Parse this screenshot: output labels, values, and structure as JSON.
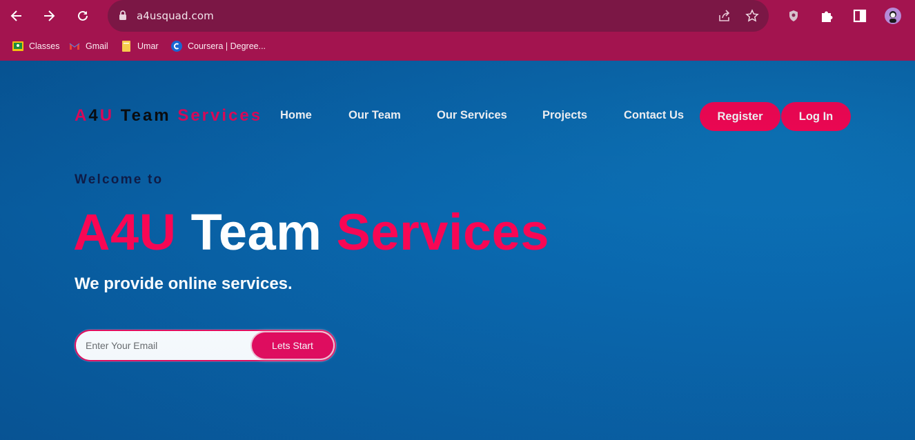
{
  "browser": {
    "url": "a4usquad.com",
    "bookmarks": [
      {
        "label": "Classes",
        "icon": "google-classroom-icon"
      },
      {
        "label": "Gmail",
        "icon": "gmail-icon"
      },
      {
        "label": "Umar",
        "icon": "folder-icon"
      },
      {
        "label": "Coursera | Degree...",
        "icon": "coursera-icon"
      }
    ],
    "colors": {
      "frame": "#a3144f",
      "omnibox": "#7b1745"
    }
  },
  "site": {
    "logo": {
      "part1": "A",
      "part2": "4",
      "part3": "U",
      "part4": "Team",
      "part5": "Services"
    },
    "nav": [
      "Home",
      "Our Team",
      "Our Services",
      "Projects",
      "Contact Us"
    ],
    "register_label": "Register",
    "login_label": "Log In",
    "welcome": "Welcome to",
    "hero": {
      "part1": "A4U",
      "part2": "Team",
      "part3": "Services"
    },
    "tagline": "We provide online services.",
    "email_placeholder": "Enter Your Email",
    "start_label": "Lets Start",
    "colors": {
      "accent": "#fa0653",
      "background": "#0a66ad",
      "welcome_text": "#0f1c47"
    }
  }
}
